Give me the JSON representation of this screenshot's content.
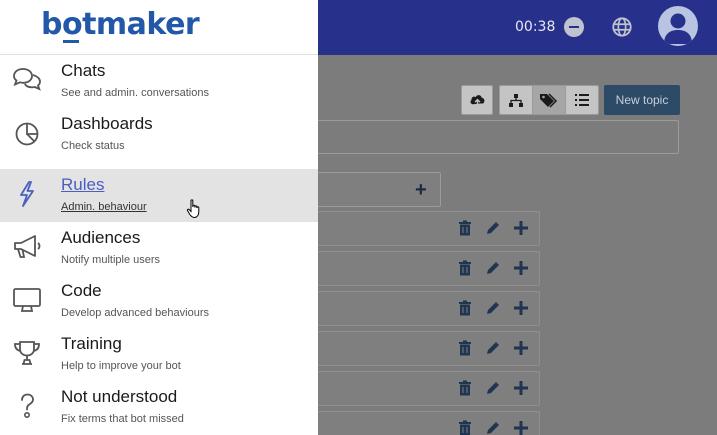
{
  "header": {
    "timer": "00:38"
  },
  "brand": {
    "logo_text": "botmaker"
  },
  "toolbar": {
    "new_topic_label": "New topic"
  },
  "colors": {
    "header_bg": "#27318b",
    "brand": "#2358a8",
    "active_link": "#4a5fc1",
    "new_topic_bg": "#2d4a66"
  },
  "menu": {
    "items": [
      {
        "title": "Chats",
        "subtitle": "See and admin. conversations",
        "icon": "chat-bubbles-icon"
      },
      {
        "title": "Dashboards",
        "subtitle": "Check status",
        "icon": "pie-chart-icon"
      },
      {
        "title": "Rules",
        "subtitle": "Admin. behaviour",
        "icon": "lightning-bolt-icon",
        "active": true
      },
      {
        "title": "Audiences",
        "subtitle": "Notify multiple users",
        "icon": "megaphone-icon"
      },
      {
        "title": "Code",
        "subtitle": "Develop advanced behaviours",
        "icon": "monitor-icon"
      },
      {
        "title": "Training",
        "subtitle": "Help to improve your bot",
        "icon": "trophy-icon"
      },
      {
        "title": "Not understood",
        "subtitle": "Fix terms that bot missed",
        "icon": "question-mark-icon"
      }
    ]
  }
}
